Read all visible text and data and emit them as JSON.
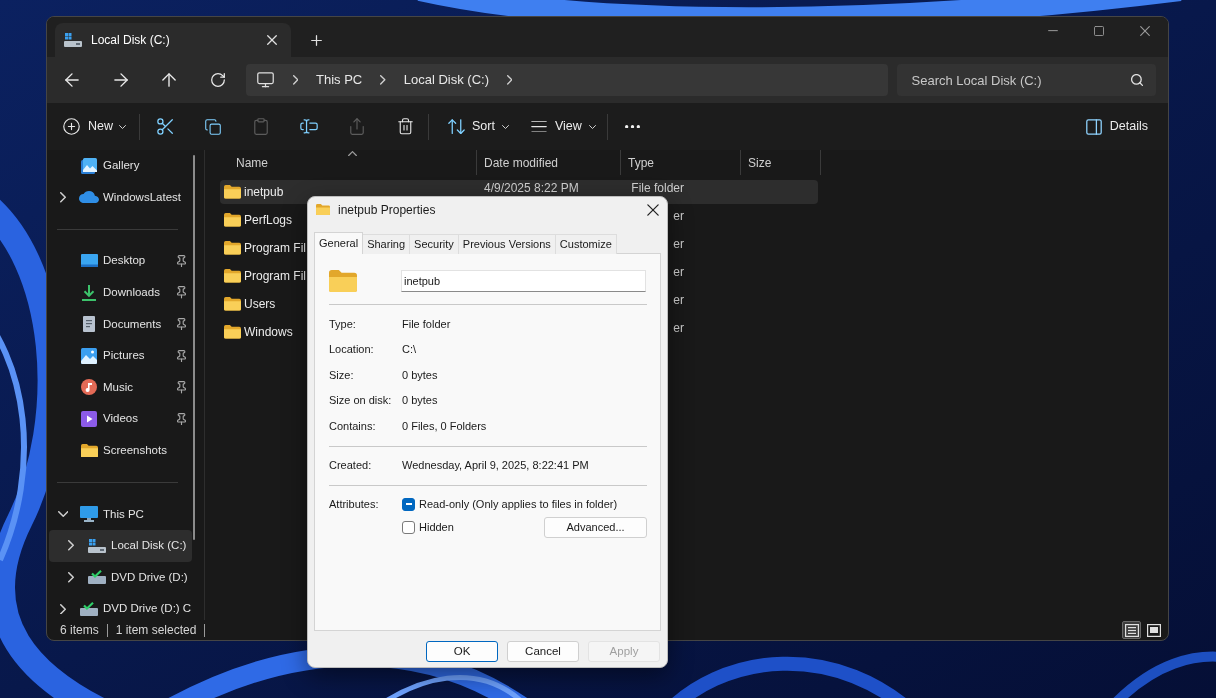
{
  "explorer": {
    "tab": {
      "title": "Local Disk (C:)"
    },
    "address_bar": {
      "breadcrumbs": [
        "This PC",
        "Local Disk (C:)"
      ]
    },
    "search": {
      "placeholder": "Search Local Disk (C:)"
    },
    "toolbar": {
      "new": {
        "label": "New"
      },
      "actions": [
        {
          "disabled": false
        },
        {
          "disabled": false
        },
        {
          "disabled": true
        },
        {
          "disabled": false
        },
        {
          "disabled": true
        },
        {
          "disabled": false
        }
      ],
      "sort": {
        "label": "Sort"
      },
      "view": {
        "label": "View"
      },
      "details": {
        "label": "Details"
      }
    },
    "sidebar": {
      "sections": [
        {
          "items": [
            {
              "kind": "gallery",
              "label": "Gallery",
              "selected": false
            },
            {
              "kind": "cloud",
              "label": "WindowsLatest",
              "expanded": false,
              "selected": false
            }
          ]
        },
        {
          "items": [
            {
              "kind": "desktop",
              "label": "Desktop",
              "pinned": true,
              "selected": false
            },
            {
              "kind": "downloads",
              "label": "Downloads",
              "pinned": true,
              "selected": false
            },
            {
              "kind": "documents",
              "label": "Documents",
              "pinned": true,
              "selected": false
            },
            {
              "kind": "pictures",
              "label": "Pictures",
              "pinned": true,
              "selected": false
            },
            {
              "kind": "music",
              "label": "Music",
              "pinned": true,
              "selected": false
            },
            {
              "kind": "videos",
              "label": "Videos",
              "pinned": true,
              "selected": false
            },
            {
              "kind": "folder",
              "label": "Screenshots",
              "pinned": false,
              "selected": false
            }
          ]
        },
        {
          "items": [
            {
              "kind": "pc",
              "label": "This PC",
              "expanded": true,
              "selected": false,
              "children": [
                {
                  "kind": "drive",
                  "label": "Local Disk (C:)",
                  "expanded": false,
                  "selected": true
                },
                {
                  "kind": "dvd",
                  "label": "DVD Drive (D:)",
                  "expanded": false,
                  "selected": false
                }
              ]
            },
            {
              "kind": "dvd",
              "label": "DVD Drive (D:) C",
              "expanded": false,
              "selected": false
            }
          ]
        }
      ]
    },
    "file_list": {
      "columns": [
        {
          "label": "Name",
          "sorted": true
        },
        {
          "label": "Date modified",
          "sorted": false
        },
        {
          "label": "Type",
          "sorted": false
        },
        {
          "label": "Size",
          "sorted": false
        }
      ],
      "rows": [
        {
          "name": "inetpub",
          "date_modified": "4/9/2025 8:22 PM",
          "type": "File folder",
          "selected": true
        },
        {
          "name": "PerfLogs",
          "type": "er",
          "selected": false
        },
        {
          "name": "Program Fil",
          "type": "er",
          "selected": false
        },
        {
          "name": "Program Fil",
          "type": "er",
          "selected": false
        },
        {
          "name": "Users",
          "type": "er",
          "selected": false
        },
        {
          "name": "Windows",
          "type": "er",
          "selected": false
        }
      ]
    },
    "status_bar": {
      "item_count": "6 items",
      "selection": "1 item selected",
      "views": [
        {
          "selected": true
        },
        {
          "selected": false
        }
      ]
    }
  },
  "dialog": {
    "title": "inetpub Properties",
    "tabs": [
      {
        "label": "General",
        "selected": true
      },
      {
        "label": "Sharing",
        "selected": false
      },
      {
        "label": "Security",
        "selected": false
      },
      {
        "label": "Previous Versions",
        "selected": false
      },
      {
        "label": "Customize",
        "selected": false
      }
    ],
    "name_field": {
      "value": "inetpub"
    },
    "groups": [
      [
        {
          "label": "Type:",
          "value": "File folder"
        },
        {
          "label": "Location:",
          "value": "C:\\"
        },
        {
          "label": "Size:",
          "value": "0 bytes"
        },
        {
          "label": "Size on disk:",
          "value": "0 bytes"
        },
        {
          "label": "Contains:",
          "value": "0 Files, 0 Folders"
        }
      ],
      [
        {
          "label": "Created:",
          "value": "Wednesday, April 9, 2025, 8:22:41 PM"
        }
      ]
    ],
    "attributes": {
      "label": "Attributes:",
      "options": [
        {
          "label": "Read-only (Only applies to files in folder)",
          "checked": true,
          "mixed": true
        },
        {
          "label": "Hidden",
          "checked": false
        }
      ],
      "advanced_button": {
        "label": "Advanced..."
      }
    },
    "buttons": [
      {
        "label": "OK",
        "default": true,
        "disabled": false
      },
      {
        "label": "Cancel",
        "default": false,
        "disabled": false
      },
      {
        "label": "Apply",
        "default": false,
        "disabled": true
      }
    ]
  }
}
